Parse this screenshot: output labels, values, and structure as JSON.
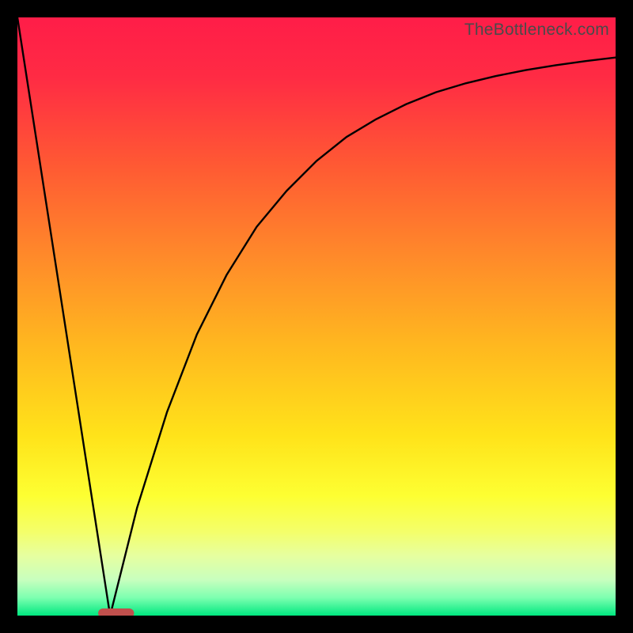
{
  "watermark": "TheBottleneck.com",
  "chart_data": {
    "type": "line",
    "title": "",
    "xlabel": "",
    "ylabel": "",
    "xlim": [
      0,
      100
    ],
    "ylim": [
      0,
      100
    ],
    "series": [
      {
        "name": "left-descent",
        "x": [
          0,
          15.5
        ],
        "values": [
          100,
          0
        ]
      },
      {
        "name": "right-curve",
        "x": [
          15.5,
          18,
          20,
          25,
          30,
          35,
          40,
          45,
          50,
          55,
          60,
          65,
          70,
          75,
          80,
          85,
          90,
          95,
          100
        ],
        "values": [
          0,
          10,
          18,
          34,
          47,
          57,
          65,
          71,
          76,
          80,
          83,
          85.5,
          87.5,
          89,
          90.2,
          91.2,
          92,
          92.7,
          93.3
        ]
      }
    ],
    "marker": {
      "name": "bottleneck-marker",
      "x_center": 16.5,
      "width": 6,
      "color": "#c0504d"
    },
    "colors": {
      "gradient_top": "#ff1d48",
      "gradient_bottom": "#00e880",
      "curve": "#000000",
      "marker": "#c0504d"
    }
  }
}
